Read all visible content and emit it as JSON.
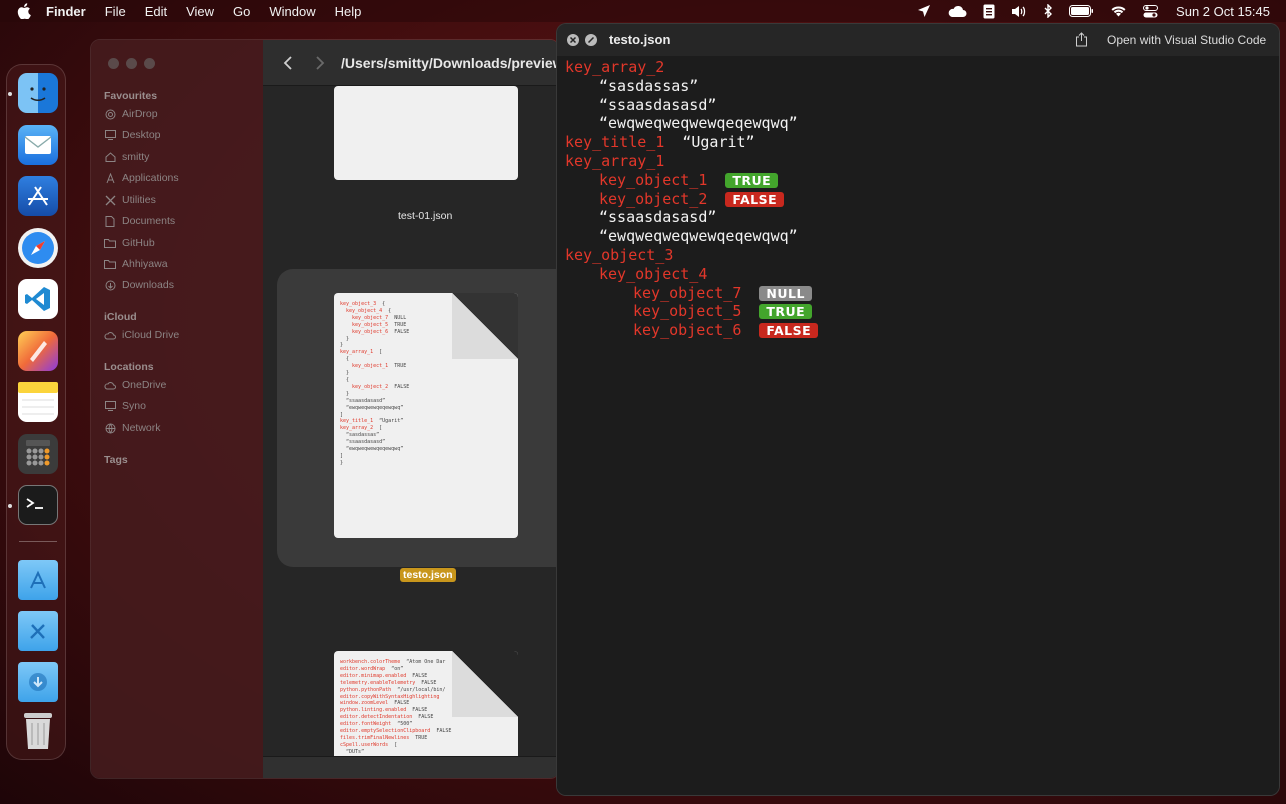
{
  "menubar": {
    "app_name": "Finder",
    "menus": [
      "File",
      "Edit",
      "View",
      "Go",
      "Window",
      "Help"
    ],
    "clock": "Sun 2 Oct  15:45",
    "status_icons": [
      "location-icon",
      "cloud-icon",
      "clipboard-icon",
      "volume-icon",
      "bluetooth-icon",
      "battery-icon",
      "wifi-icon",
      "control-center-icon"
    ]
  },
  "dock": {
    "apps": [
      "finder-icon",
      "mail-icon",
      "xcode-icon",
      "safari-icon",
      "vscode-icon",
      "pixelmator-icon",
      "notes-icon",
      "calculator-icon",
      "terminal-icon",
      "applications-folder-icon",
      "utilities-folder-icon",
      "downloads-folder-icon",
      "trash-icon"
    ]
  },
  "finder": {
    "path": "/Users/smitty/Downloads/preview",
    "sidebar": {
      "favourites_header": "Favourites",
      "favourites": [
        {
          "label": "AirDrop",
          "icon": "airdrop-icon"
        },
        {
          "label": "Desktop",
          "icon": "desktop-icon"
        },
        {
          "label": "smitty",
          "icon": "home-icon"
        },
        {
          "label": "Applications",
          "icon": "applications-icon"
        },
        {
          "label": "Utilities",
          "icon": "utilities-icon"
        },
        {
          "label": "Documents",
          "icon": "document-icon"
        },
        {
          "label": "GitHub",
          "icon": "folder-icon"
        },
        {
          "label": "Ahhiyawa",
          "icon": "folder-icon"
        },
        {
          "label": "Downloads",
          "icon": "download-icon"
        }
      ],
      "icloud_header": "iCloud",
      "icloud": [
        {
          "label": "iCloud Drive",
          "icon": "cloud-icon"
        }
      ],
      "locations_header": "Locations",
      "locations": [
        {
          "label": "OneDrive",
          "icon": "cloud-icon"
        },
        {
          "label": "Syno",
          "icon": "display-icon"
        },
        {
          "label": "Network",
          "icon": "network-icon"
        }
      ],
      "tags_header": "Tags"
    },
    "files": [
      {
        "name": "test-01.json"
      },
      {
        "name": "testo.json",
        "selected": true
      },
      {
        "name": ""
      }
    ]
  },
  "quicklook": {
    "title": "testo.json",
    "open_with": "Open with Visual Studio Code",
    "lines": [
      {
        "key": "key_array_2"
      },
      {
        "str": "“sasdassas”"
      },
      {
        "str": "“ssaasdasasd”"
      },
      {
        "str": "“ewqweqweqwewqeqewqwq”"
      },
      {
        "key": "key_title_1",
        "str": "“Ugarit”"
      },
      {
        "key": "key_array_1"
      },
      {
        "key": "key_object_1",
        "badge": "TRUE"
      },
      {
        "key": "key_object_2",
        "badge": "FALSE"
      },
      {
        "str": "“ssaasdasasd”"
      },
      {
        "str": "“ewqweqweqwewqeqewqwq”"
      },
      {
        "key": "key_object_3"
      },
      {
        "key": "key_object_4"
      },
      {
        "key": "key_object_7",
        "badge": "NULL"
      },
      {
        "key": "key_object_5",
        "badge": "TRUE"
      },
      {
        "key": "key_object_6",
        "badge": "FALSE"
      }
    ]
  },
  "thumbnails": {
    "testo_preview": [
      {
        "k": "key_object_3",
        "v": "{"
      },
      {
        "k": "  key_object_4",
        "v": "{"
      },
      {
        "k": "    key_object_7",
        "v": "NULL"
      },
      {
        "k": "    key_object_5",
        "v": "TRUE"
      },
      {
        "k": "    key_object_6",
        "v": "FALSE"
      },
      {
        "k": "",
        "v": "  }"
      },
      {
        "k": "",
        "v": "}"
      },
      {
        "k": "key_array_1",
        "v": "["
      },
      {
        "k": "",
        "v": "  {"
      },
      {
        "k": "    key_object_1",
        "v": "TRUE"
      },
      {
        "k": "",
        "v": "  }"
      },
      {
        "k": "",
        "v": "  {"
      },
      {
        "k": "    key_object_2",
        "v": "FALSE"
      },
      {
        "k": "",
        "v": "  }"
      },
      {
        "k": "",
        "v": "  “ssaasdasasd”"
      },
      {
        "k": "",
        "v": "  “ewqweqwewqeqewqwq”"
      },
      {
        "k": "",
        "v": "]"
      },
      {
        "k": "key_title_1",
        "v": "“Ugarit”"
      },
      {
        "k": "key_array_2",
        "v": "["
      },
      {
        "k": "",
        "v": "  “sasdassas”"
      },
      {
        "k": "",
        "v": "  “ssaasdasasd”"
      },
      {
        "k": "",
        "v": "  “ewqweqwewqeqewqwq”"
      },
      {
        "k": "",
        "v": "]"
      },
      {
        "k": "",
        "v": "}"
      }
    ],
    "settings_preview": [
      {
        "k": "workbench.colorTheme",
        "v": "“Atom One Dar"
      },
      {
        "k": "editor.wordWrap",
        "v": "“on”"
      },
      {
        "k": "editor.minimap.enabled",
        "v": "FALSE"
      },
      {
        "k": "telemetry.enableTelemetry",
        "v": "FALSE"
      },
      {
        "k": "python.pythonPath",
        "v": "“/usr/local/bin/"
      },
      {
        "k": "editor.copyWithSyntaxHighlighting",
        "v": ""
      },
      {
        "k": "window.zoomLevel",
        "v": "FALSE"
      },
      {
        "k": "python.linting.enabled",
        "v": "FALSE"
      },
      {
        "k": "editor.detectIndentation",
        "v": "FALSE"
      },
      {
        "k": "editor.fontWeight",
        "v": "“500”"
      },
      {
        "k": "editor.emptySelectionClipboard",
        "v": "FALSE"
      },
      {
        "k": "files.trimFinalNewlines",
        "v": "TRUE"
      },
      {
        "k": "cSpell.userWords",
        "v": "["
      },
      {
        "k": "",
        "v": "  “DUTs”"
      }
    ]
  }
}
